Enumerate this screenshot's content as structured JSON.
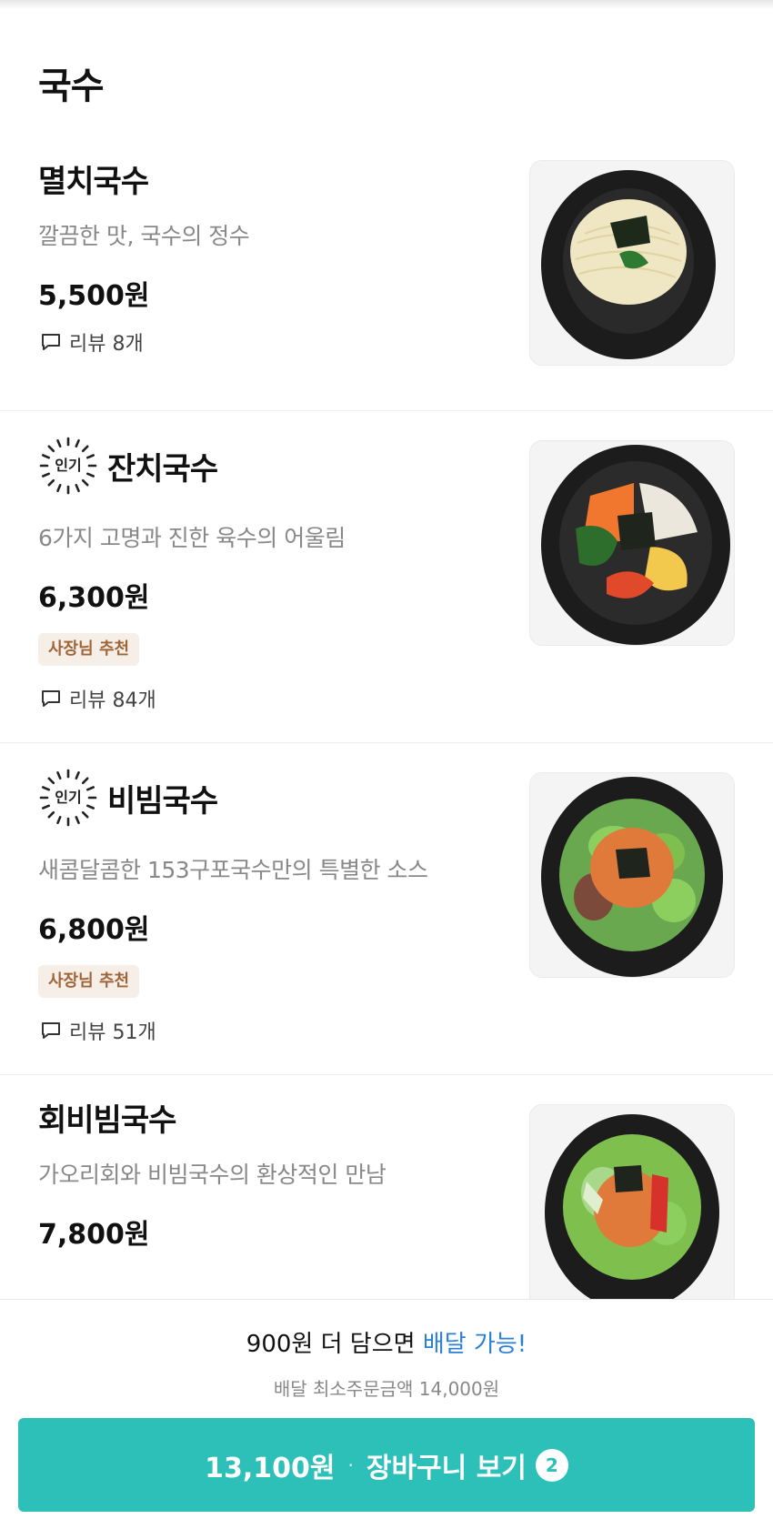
{
  "section": {
    "title": "국수"
  },
  "menu": [
    {
      "name": "멸치국수",
      "popular": false,
      "description": "깔끔한 맛, 국수의 정수",
      "price": "5,500원",
      "owner_pick": "",
      "review": "리뷰 8개",
      "image_icon": "anchovy-noodle-photo"
    },
    {
      "name": "잔치국수",
      "popular": true,
      "popular_label": "인기",
      "description": "6가지 고명과 진한 육수의 어울림",
      "price": "6,300원",
      "owner_pick": "사장님 추천",
      "review": "리뷰 84개",
      "image_icon": "banquet-noodle-photo"
    },
    {
      "name": "비빔국수",
      "popular": true,
      "popular_label": "인기",
      "description": "새콤달콤한 153구포국수만의 특별한 소스",
      "price": "6,800원",
      "owner_pick": "사장님 추천",
      "review": "리뷰 51개",
      "image_icon": "spicy-noodle-photo"
    },
    {
      "name": "회비빔국수",
      "popular": false,
      "description": "가오리회와 비빔국수의 환상적인 만남",
      "price": "7,800원",
      "owner_pick": "",
      "review": "",
      "image_icon": "raw-fish-noodle-photo"
    }
  ],
  "cart": {
    "notice_prefix": "900원 더 담으면 ",
    "notice_highlight": "배달 가능!",
    "min_order": "배달 최소주문금액 14,000원",
    "total": "13,100원",
    "separator": "·",
    "label": "장바구니 보기",
    "count": "2"
  },
  "colors": {
    "accent": "#2cc0b8",
    "highlight": "#2a7fd6",
    "owner_badge_text": "#a0643a",
    "owner_badge_bg": "#f6efe7"
  },
  "icons": {
    "review": "speech-bubble-icon",
    "popular": "sunburst-badge-icon"
  }
}
